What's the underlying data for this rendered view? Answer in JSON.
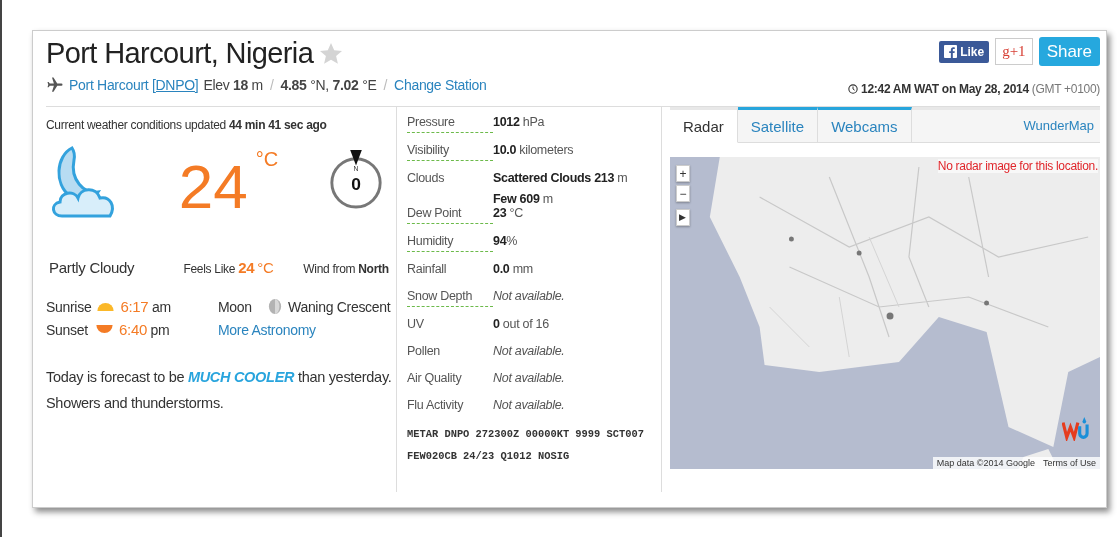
{
  "location": {
    "title": "Port Harcourt, Nigeria",
    "favorite": false
  },
  "station": {
    "name": "Port Harcourt",
    "code": "[DNPO]",
    "elev_label": "Elev",
    "elev_value": "18",
    "elev_unit": "m",
    "lat_value": "4.85",
    "lat_unit": "°N,",
    "lon_value": "7.02",
    "lon_unit": "°E",
    "change_link": "Change Station",
    "separator": "/"
  },
  "social": {
    "like": "Like",
    "plus": "g+1",
    "share": "Share"
  },
  "time": {
    "local": "12:42 AM WAT on May 28, 2014",
    "offset": "(GMT +0100)"
  },
  "current": {
    "updated_label": "Current weather conditions updated",
    "updated_value": "44 min 41 sec ago",
    "temperature": "24",
    "temp_unit": "°C",
    "condition": "Partly Cloudy",
    "feels_label": "Feels Like",
    "feels_value": "24",
    "feels_unit": "°C",
    "compass_mark": "N",
    "wind_speed": "0",
    "wind_label": "Wind from",
    "wind_dir": "North"
  },
  "astronomy": {
    "sunrise_label": "Sunrise",
    "sunrise_time": "6:17",
    "sunrise_period": "am",
    "sunset_label": "Sunset",
    "sunset_time": "6:40",
    "sunset_period": "pm",
    "moon_label": "Moon",
    "moon_phase": "Waning Crescent",
    "more_link": "More Astronomy"
  },
  "forecast": {
    "before": "Today is forecast to be",
    "highlight": "MUCH COOLER",
    "after": "than yesterday.",
    "detail": "Showers and thunderstorms."
  },
  "conditions": [
    {
      "label": "Pressure",
      "has_definition": true,
      "values": [
        {
          "strong": "1012",
          "unit": "hPa"
        }
      ]
    },
    {
      "label": "Visibility",
      "has_definition": true,
      "values": [
        {
          "strong": "10.0",
          "unit": "kilometers"
        }
      ]
    },
    {
      "label": "Clouds",
      "has_definition": false,
      "values": [
        {
          "strong": "Scattered Clouds 213",
          "unit": "m"
        },
        {
          "strong": "Few 609",
          "unit": "m"
        }
      ]
    },
    {
      "label": "Dew Point",
      "has_definition": true,
      "values": [
        {
          "strong": "23",
          "unit": "°C"
        }
      ]
    },
    {
      "label": "Humidity",
      "has_definition": true,
      "values": [
        {
          "strong": "94",
          "unit": "%"
        }
      ]
    },
    {
      "label": "Rainfall",
      "has_definition": false,
      "values": [
        {
          "strong": "0.0",
          "unit": "mm"
        }
      ]
    },
    {
      "label": "Snow Depth",
      "has_definition": true,
      "note": "Not available."
    },
    {
      "label": "UV",
      "has_definition": false,
      "values": [
        {
          "strong": "0",
          "unit": "out of 16"
        }
      ]
    },
    {
      "label": "Pollen",
      "has_definition": false,
      "note": "Not available."
    },
    {
      "label": "Air Quality",
      "has_definition": false,
      "note": "Not available."
    },
    {
      "label": "Flu Activity",
      "has_definition": false,
      "note": "Not available."
    }
  ],
  "metar": "METAR DNPO 272300Z 00000KT 9999 SCT007 FEW020CB 24/23 Q1012 NOSIG",
  "map": {
    "tabs": [
      {
        "label": "Radar",
        "selected": true
      },
      {
        "label": "Satellite",
        "selected": false
      },
      {
        "label": "Webcams",
        "selected": false
      }
    ],
    "wundermap_link": "WunderMap",
    "message": "No radar image for this location.",
    "zoom_in": "+",
    "zoom_out": "−",
    "play": "▶",
    "attribution": "Map data ©2014 Google",
    "terms": "Terms of Use"
  }
}
